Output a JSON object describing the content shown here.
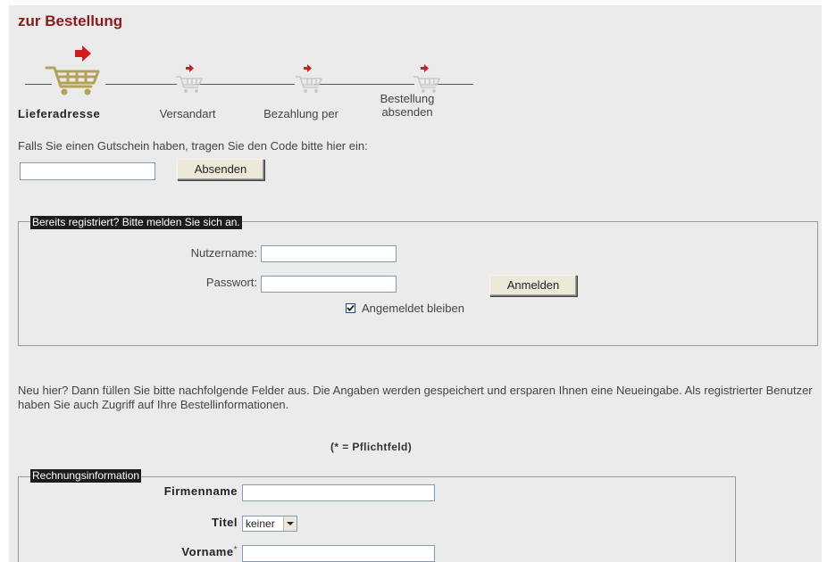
{
  "title": "zur Bestellung",
  "steps": [
    {
      "label": "Lieferadresse",
      "active": true
    },
    {
      "label": "Versandart",
      "active": false
    },
    {
      "label": "Bezahlung per",
      "active": false
    },
    {
      "label": "Bestellung\nabsenden",
      "active": false
    }
  ],
  "voucher": {
    "prompt": "Falls Sie einen Gutschein haben, tragen Sie den Code bitte hier ein:",
    "input_value": "",
    "submit_label": "Absenden"
  },
  "login": {
    "legend": "Bereits registriert? Bitte melden Sie sich an.",
    "username_label": "Nutzername:",
    "username_value": "",
    "password_label": "Passwort:",
    "password_value": "",
    "login_button": "Anmelden",
    "remember_label": "Angemeldet bleiben",
    "remember_checked": true
  },
  "new_customer": {
    "text": "Neu hier? Dann füllen Sie bitte nachfolgende Felder aus. Die Angaben werden gespeichert und ersparen Ihnen eine Neueingabe. Als registrierter Benutzer haben Sie auch Zugriff auf Ihre Bestellinformationen.",
    "required_note": "(* = Pflichtfeld)"
  },
  "billing": {
    "legend": "Rechnungsinformation",
    "company_label": "Firmenname",
    "company_value": "",
    "salutation_label": "Titel",
    "salutation_value": "keiner",
    "firstname_label": "Vorname",
    "firstname_required_marker": "*",
    "firstname_value": ""
  },
  "icons": {
    "cart": "shopping-cart-icon",
    "arrow": "red-arrow-icon",
    "checkbox_mark": "check-icon",
    "select_arrow": "chevron-down-icon"
  },
  "colors": {
    "title": "#8b1a1a",
    "arrow": "#d01c1c",
    "cart_active": "#b5a25a",
    "cart_inactive": "#c9c9c9",
    "panel_bg": "#ebebeb"
  }
}
